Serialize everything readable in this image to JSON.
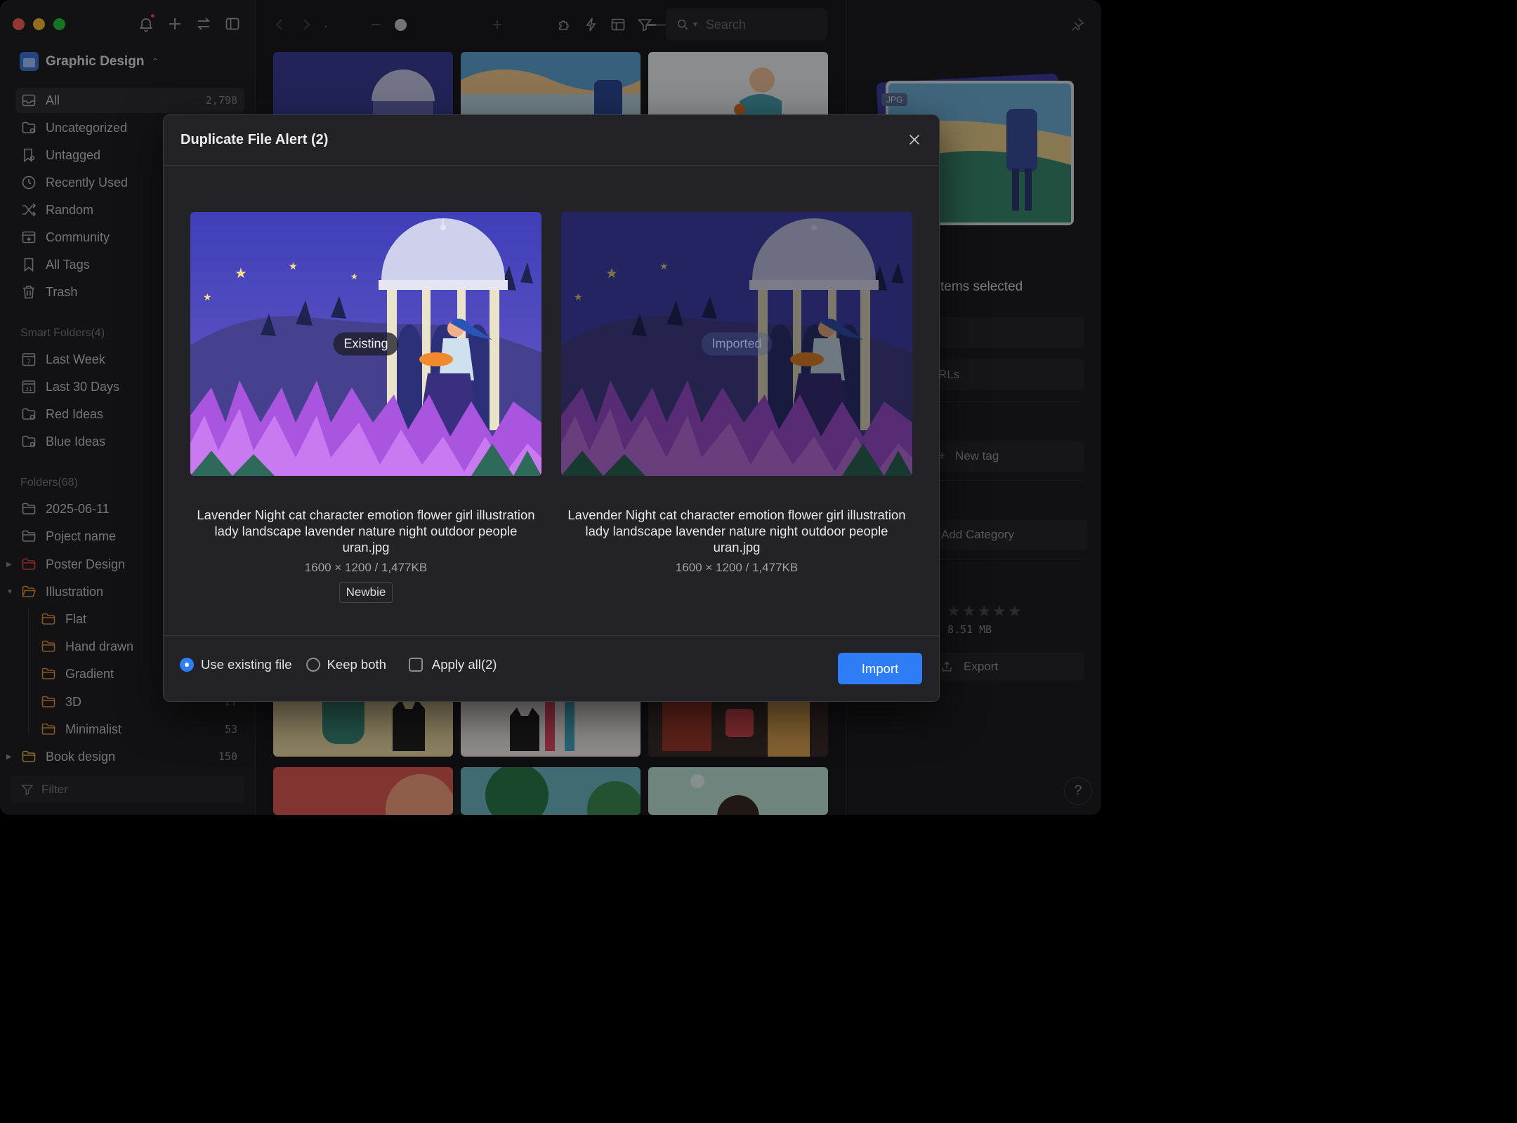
{
  "window": {
    "traffic_lights": [
      "close",
      "minimize",
      "zoom"
    ]
  },
  "sidebar": {
    "library_name": "Graphic Design",
    "items": [
      {
        "label": "All",
        "count": "2,798",
        "icon": "inbox-icon"
      },
      {
        "label": "Uncategorized",
        "icon": "folder-question-icon"
      },
      {
        "label": "Untagged",
        "icon": "tag-question-icon"
      },
      {
        "label": "Recently Used",
        "icon": "clock-icon"
      },
      {
        "label": "Random",
        "icon": "shuffle-icon"
      },
      {
        "label": "Community",
        "icon": "download-box-icon"
      },
      {
        "label": "All Tags",
        "icon": "bookmark-icon"
      },
      {
        "label": "Trash",
        "icon": "trash-icon"
      }
    ],
    "smart_title": "Smart Folders(4)",
    "smart": [
      {
        "label": "Last Week",
        "icon_text": "7"
      },
      {
        "label": "Last 30 Days",
        "icon_text": "31"
      },
      {
        "label": "Red Ideas"
      },
      {
        "label": "Blue Ideas"
      }
    ],
    "folders_title": "Folders(68)",
    "folders": [
      {
        "label": "2025-06-11"
      },
      {
        "label": "Poject name"
      },
      {
        "label": "Poster Design",
        "color": "#e04848"
      },
      {
        "label": "Illustration",
        "color": "#e8923a"
      },
      {
        "label": "Flat",
        "color": "#e8923a"
      },
      {
        "label": "Hand drawn",
        "color": "#e8923a"
      },
      {
        "label": "Gradient",
        "color": "#e8923a"
      },
      {
        "label": "3D",
        "color": "#e8923a",
        "count": "27"
      },
      {
        "label": "Minimalist",
        "color": "#e8923a",
        "count": "53"
      },
      {
        "label": "Book design",
        "color": "#e8b93a",
        "count": "150"
      }
    ],
    "filter_placeholder": "Filter"
  },
  "toolbar": {
    "search_placeholder": "Search"
  },
  "right_panel": {
    "badge": "JPG",
    "selection": "tems selected",
    "urls": "RLs",
    "new_tag": "New tag",
    "add_category": "Add Category",
    "size": "8.51 MB",
    "export": "Export",
    "help": "?"
  },
  "modal": {
    "title": "Duplicate File Alert (2)",
    "existing": {
      "badge": "Existing",
      "name": "Lavender Night cat character emotion flower girl illustration lady landscape lavender nature night outdoor people uran.jpg",
      "meta": "1600 × 1200 / 1,477KB",
      "tag": "Newbie"
    },
    "imported": {
      "badge": "Imported",
      "name": "Lavender Night cat character emotion flower girl illustration lady landscape lavender nature night outdoor people uran.jpg",
      "meta": "1600 × 1200 / 1,477KB"
    },
    "options": {
      "use_existing": "Use existing file",
      "keep_both": "Keep both",
      "apply_all": "Apply all(2)",
      "selected": "use_existing"
    },
    "import_label": "Import"
  },
  "colors": {
    "accent": "#2e7cf6",
    "background": "#1b1b1f",
    "sidebar": "#202024",
    "modal": "#232327"
  }
}
